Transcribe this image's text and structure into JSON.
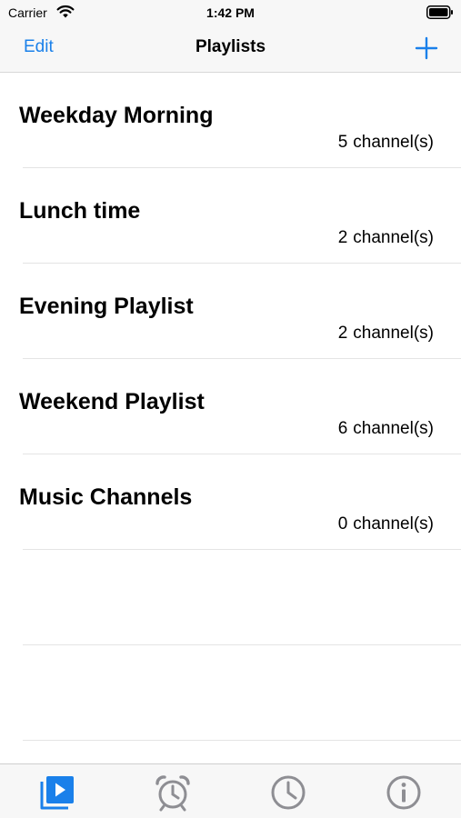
{
  "status_bar": {
    "carrier": "Carrier",
    "time": "1:42 PM"
  },
  "nav": {
    "edit_label": "Edit",
    "title": "Playlists",
    "add_icon": "plus-icon"
  },
  "playlists": [
    {
      "title": "Weekday Morning",
      "count": "5",
      "suffix": "channel(s)"
    },
    {
      "title": "Lunch time",
      "count": "2",
      "suffix": "channel(s)"
    },
    {
      "title": "Evening Playlist",
      "count": "2",
      "suffix": "channel(s)"
    },
    {
      "title": "Weekend Playlist",
      "count": "6",
      "suffix": "channel(s)"
    },
    {
      "title": "Music Channels",
      "count": "0",
      "suffix": "channel(s)"
    }
  ],
  "tabs": [
    {
      "icon": "playlist-play-icon",
      "selected": true
    },
    {
      "icon": "alarm-clock-icon",
      "selected": false
    },
    {
      "icon": "clock-icon",
      "selected": false
    },
    {
      "icon": "info-icon",
      "selected": false
    }
  ],
  "colors": {
    "accent": "#1a80ea",
    "inactive_icon": "#8e8e93",
    "bar_background": "#f7f7f7"
  }
}
